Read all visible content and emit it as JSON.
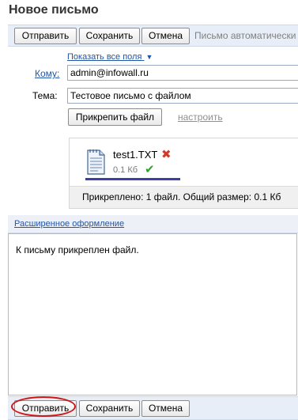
{
  "page": {
    "title": "Новое письмо"
  },
  "toolbar_top": {
    "send_label": "Отправить",
    "save_label": "Сохранить",
    "cancel_label": "Отмена",
    "autosave_note": "Письмо автоматически"
  },
  "form": {
    "show_all_fields": "Показать все поля",
    "to_label": "Кому:",
    "to_value": "admin@infowall.ru",
    "subject_label": "Тема:",
    "subject_value": "Тестовое письмо с файлом",
    "attach_button": "Прикрепить файл",
    "configure_link": "настроить"
  },
  "attachment": {
    "file_name": "test1.TXT",
    "file_size": "0.1 Кб",
    "status_color": "#2aa52a",
    "remove_color": "#d23b2b",
    "progress_percent": 100,
    "summary": "Прикреплено: 1 файл. Общий размер: 0.1 Кб"
  },
  "advanced_link": "Расширенное оформление",
  "editor": {
    "body_text": "К письму прикреплен файл."
  },
  "toolbar_bottom": {
    "send_label": "Отправить",
    "save_label": "Сохранить",
    "cancel_label": "Отмена"
  },
  "colors": {
    "accent_link": "#2355a3",
    "highlight_circle": "#d0141b"
  }
}
